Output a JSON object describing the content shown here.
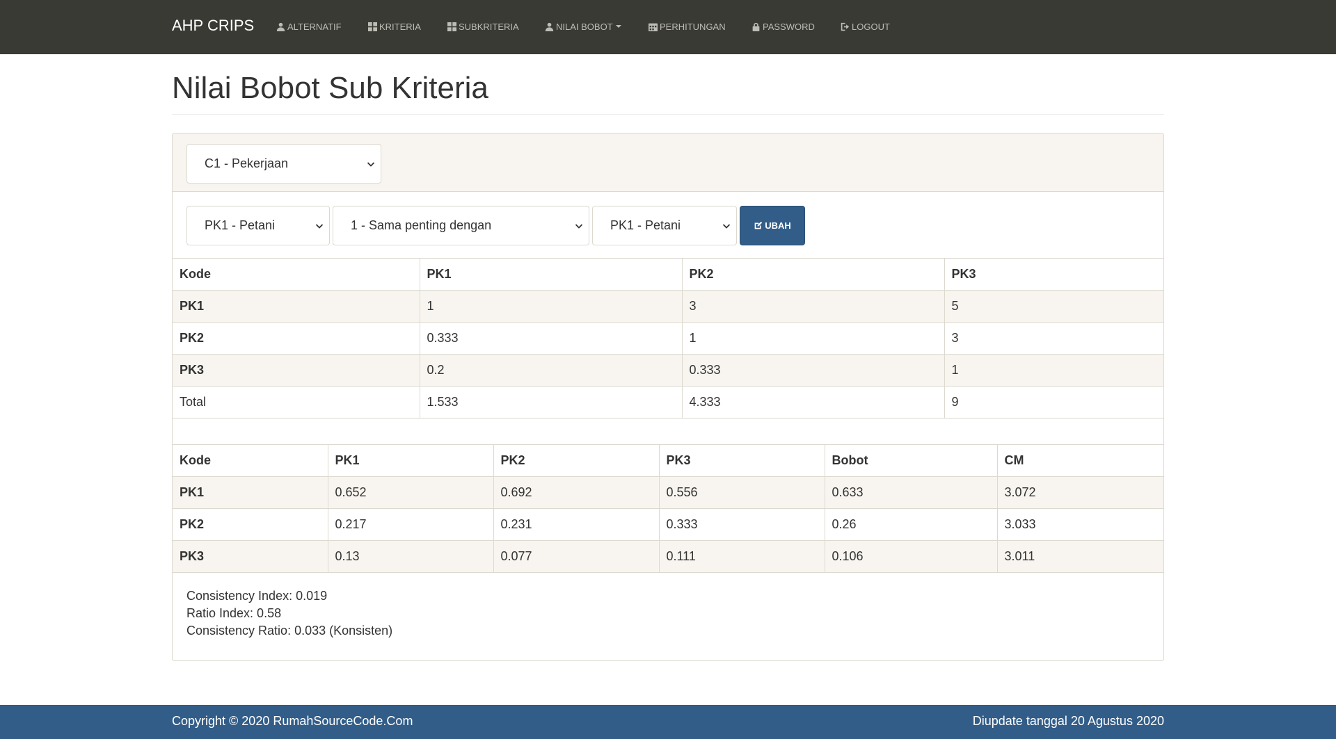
{
  "navbar": {
    "brand": "AHP CRIPS",
    "items": [
      {
        "label": "ALTERNATIF",
        "icon": "user-icon"
      },
      {
        "label": "KRITERIA",
        "icon": "grid-icon"
      },
      {
        "label": "SUBKRITERIA",
        "icon": "grid-icon"
      },
      {
        "label": "NILAI BOBOT",
        "icon": "user-icon",
        "dropdown": true
      },
      {
        "label": "PERHITUNGAN",
        "icon": "calendar-icon"
      },
      {
        "label": "PASSWORD",
        "icon": "lock-icon"
      },
      {
        "label": "LOGOUT",
        "icon": "logout-icon"
      }
    ]
  },
  "page": {
    "title": "Nilai Bobot Sub Kriteria"
  },
  "filter": {
    "kriteria_selected": "C1 - Pekerjaan"
  },
  "form": {
    "left_selected": "PK1 - Petani",
    "value_selected": "1 - Sama penting dengan",
    "right_selected": "PK1 - Petani",
    "button_label": "UBAH"
  },
  "matrix": {
    "headers": [
      "Kode",
      "PK1",
      "PK2",
      "PK3"
    ],
    "rows": [
      [
        "PK1",
        "1",
        "3",
        "5"
      ],
      [
        "PK2",
        "0.333",
        "1",
        "3"
      ],
      [
        "PK3",
        "0.2",
        "0.333",
        "1"
      ]
    ],
    "total": [
      "Total",
      "1.533",
      "4.333",
      "9"
    ]
  },
  "normalized": {
    "headers": [
      "Kode",
      "PK1",
      "PK2",
      "PK3",
      "Bobot",
      "CM"
    ],
    "rows": [
      [
        "PK1",
        "0.652",
        "0.692",
        "0.556",
        "0.633",
        "3.072"
      ],
      [
        "PK2",
        "0.217",
        "0.231",
        "0.333",
        "0.26",
        "3.033"
      ],
      [
        "PK3",
        "0.13",
        "0.077",
        "0.111",
        "0.106",
        "3.011"
      ]
    ]
  },
  "summary": {
    "consistency_index": "Consistency Index: 0.019",
    "ratio_index": "Ratio Index: 0.58",
    "consistency_ratio": "Consistency Ratio: 0.033 (Konsisten)"
  },
  "footer": {
    "copyright": "Copyright © 2020 RumahSourceCode.Com",
    "updated": "Diupdate tanggal 20 Agustus 2020"
  },
  "colors": {
    "navbar": "#3a3a35",
    "primary": "#325d88",
    "stripe": "#f8f5f0",
    "border": "#dcd9cf"
  }
}
